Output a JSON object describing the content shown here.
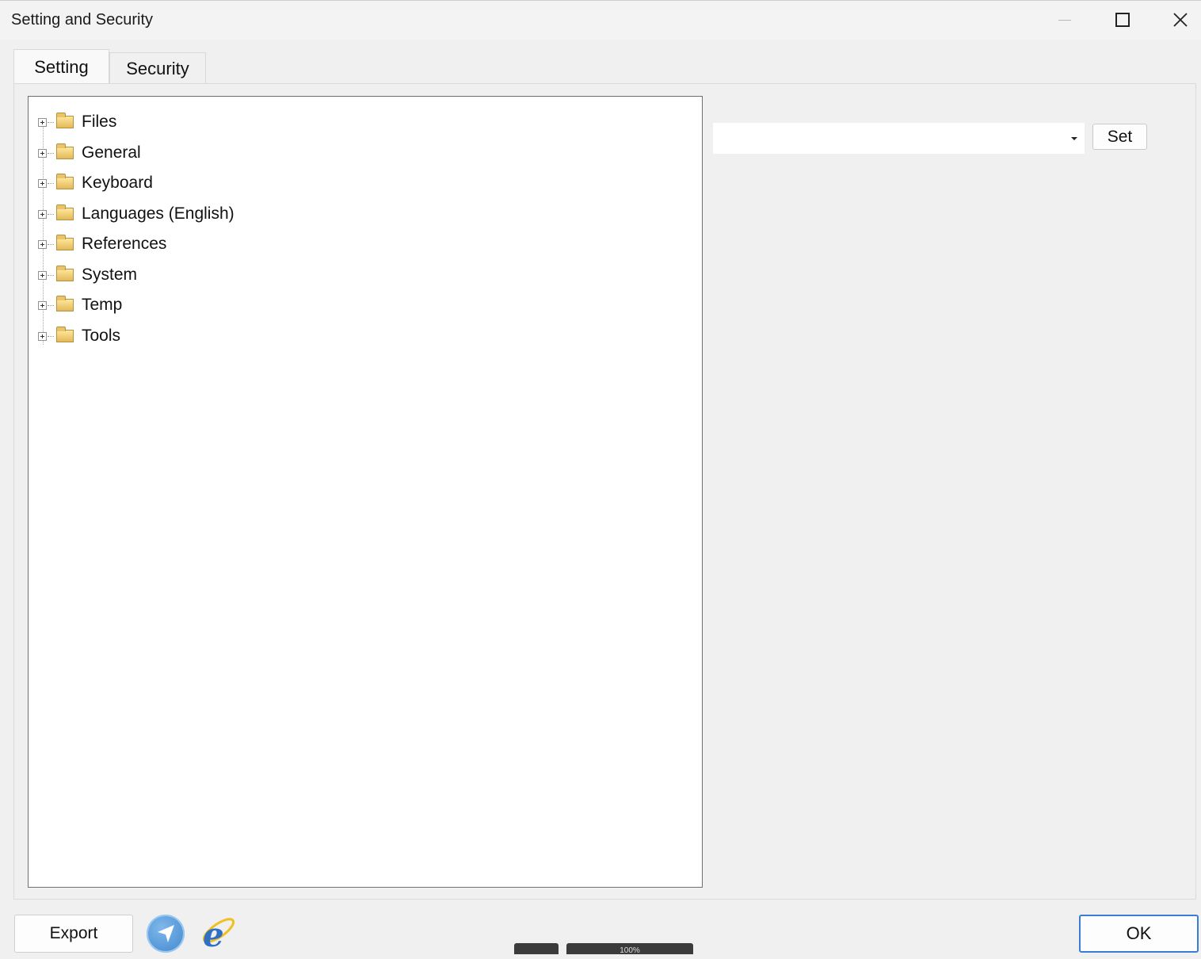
{
  "window": {
    "title": "Setting and Security"
  },
  "tabs": [
    {
      "label": "Setting",
      "active": true
    },
    {
      "label": "Security",
      "active": false
    }
  ],
  "tree": {
    "items": [
      {
        "label": "Files",
        "icon": "folder-icon"
      },
      {
        "label": "General",
        "icon": "folder-icon"
      },
      {
        "label": "Keyboard",
        "icon": "folder-icon"
      },
      {
        "label": "Languages (English)",
        "icon": "folder-icon"
      },
      {
        "label": "References",
        "icon": "folder-icon"
      },
      {
        "label": "System",
        "icon": "folder-icon"
      },
      {
        "label": "Temp",
        "icon": "folder-icon"
      },
      {
        "label": "Tools",
        "icon": "folder-icon"
      }
    ]
  },
  "value_selector": {
    "value": "",
    "set_label": "Set"
  },
  "footer": {
    "export_label": "Export",
    "ok_label": "OK",
    "zoom_text": "100%"
  },
  "colors": {
    "ok_border": "#3a7cd6",
    "background": "#f0f0f0",
    "folder": "#e3b95a"
  }
}
